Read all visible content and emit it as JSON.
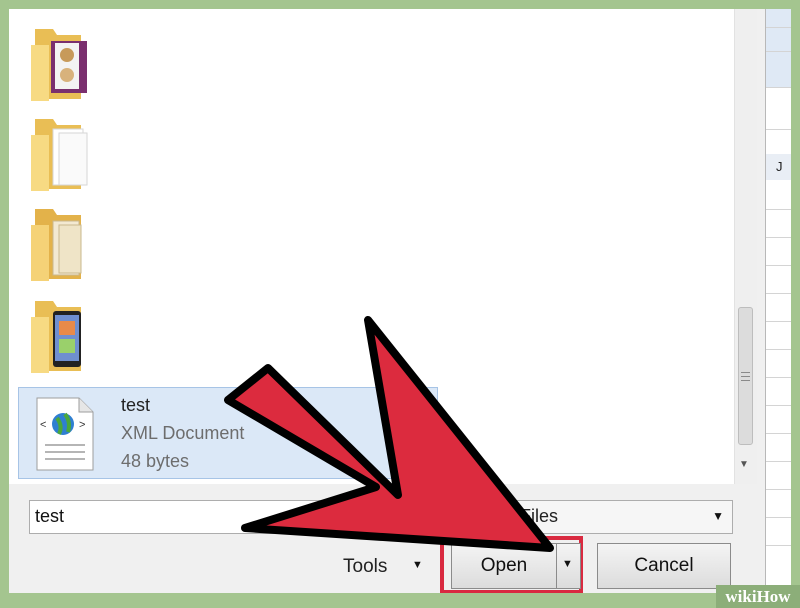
{
  "file_list": {
    "selected_item": {
      "name": "test",
      "type": "XML Document",
      "size": "48 bytes"
    }
  },
  "footer": {
    "file_name_value": "test",
    "file_type_value": "Files",
    "tools_label": "Tools",
    "open_label": "Open",
    "cancel_label": "Cancel"
  },
  "background": {
    "column_letter": "J"
  },
  "watermark": "wikiHow",
  "colors": {
    "arrow": "#dc2b3e",
    "highlight": "#d92a40",
    "folder": "#f3d27a",
    "selection": "#dbe8f7"
  },
  "icons": [
    "folder-icon",
    "xml-file-icon",
    "dropdown-arrow-icon",
    "split-arrow-icon",
    "scroll-down-icon"
  ]
}
